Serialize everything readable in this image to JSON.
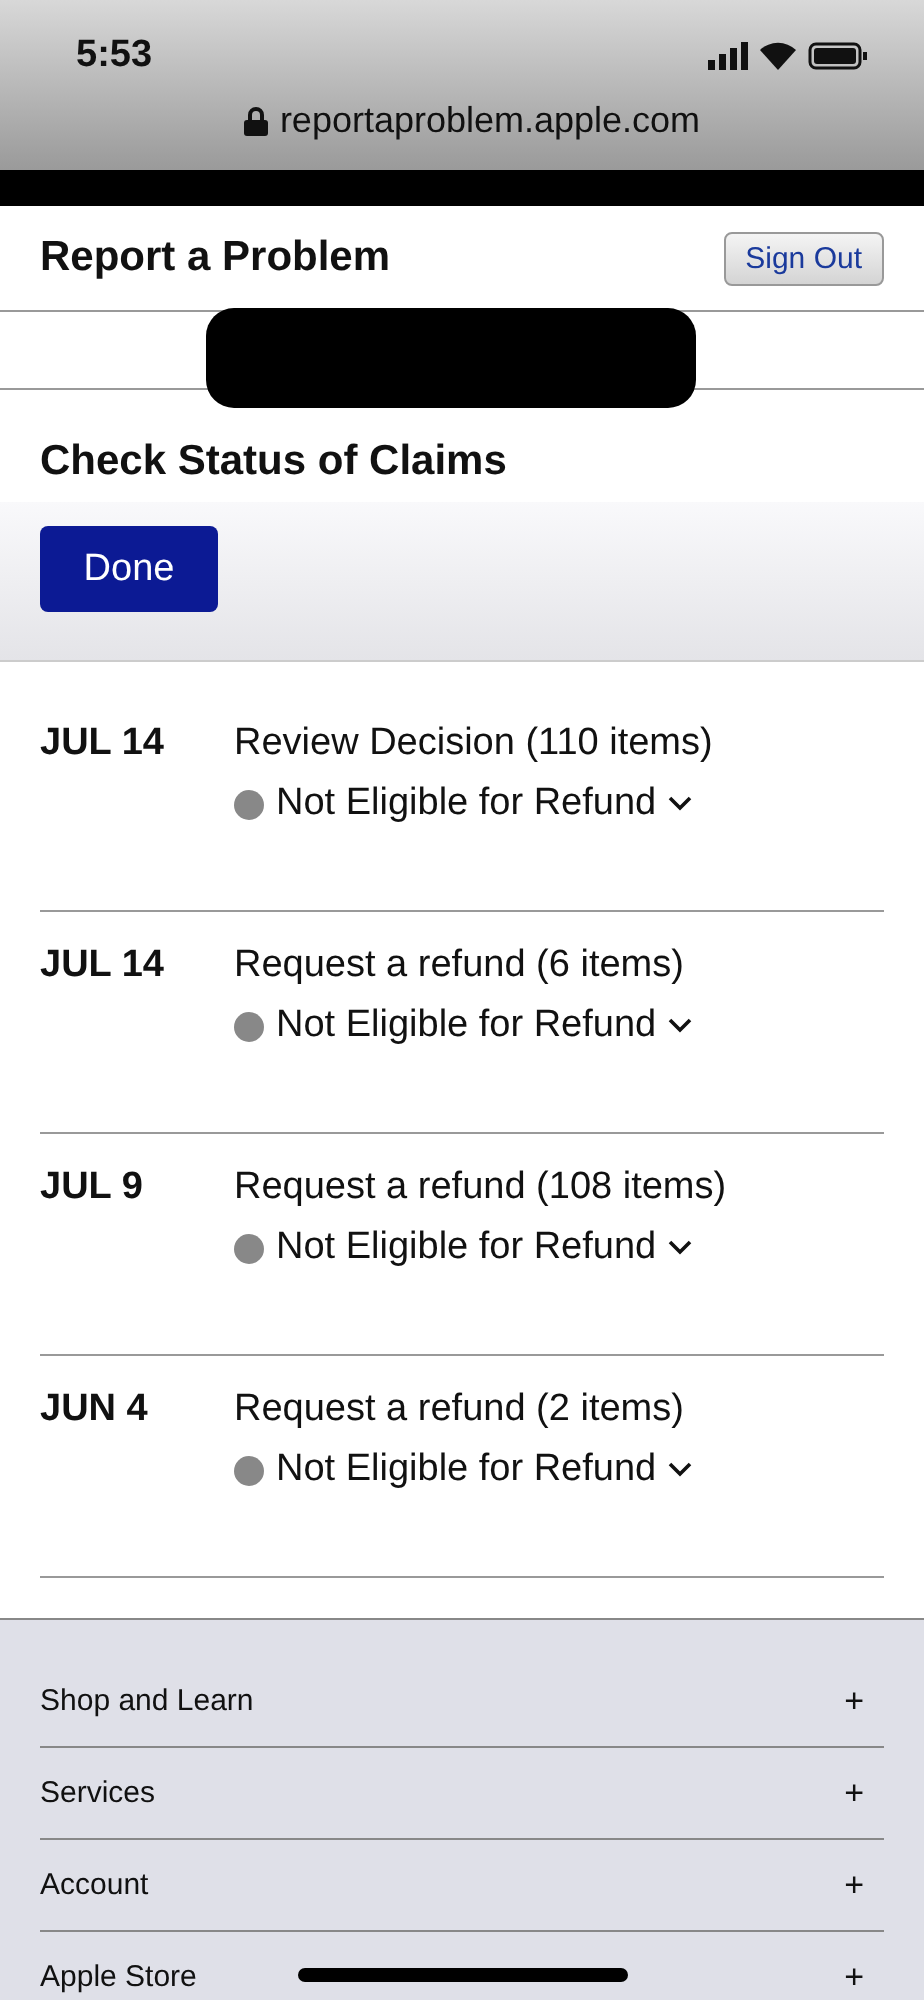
{
  "status_bar": {
    "time": "5:53"
  },
  "address_bar": {
    "url": "reportaproblem.apple.com"
  },
  "header": {
    "title": "Report a Problem",
    "sign_out": "Sign Out"
  },
  "section": {
    "title": "Check Status of Claims",
    "done": "Done"
  },
  "claims": [
    {
      "date": "JUL 14",
      "title": "Review Decision (110 items)",
      "status": "Not Eligible for Refund",
      "expanded": false
    },
    {
      "date": "JUL 14",
      "title": "Request a refund (6 items)",
      "status": "Not Eligible for Refund",
      "expanded": false
    },
    {
      "date": "JUL 9",
      "title": "Request a refund (108 items)",
      "status": "Not Eligible for Refund",
      "expanded": false
    },
    {
      "date": "JUN 4",
      "title": "Request a refund (2 items)",
      "status": "Not Eligible for Refund",
      "expanded": false
    }
  ],
  "footer": [
    {
      "label": "Shop and Learn",
      "toggle": "+"
    },
    {
      "label": "Services",
      "toggle": "+"
    },
    {
      "label": "Account",
      "toggle": "+"
    },
    {
      "label": "Apple Store",
      "toggle": "+"
    }
  ]
}
